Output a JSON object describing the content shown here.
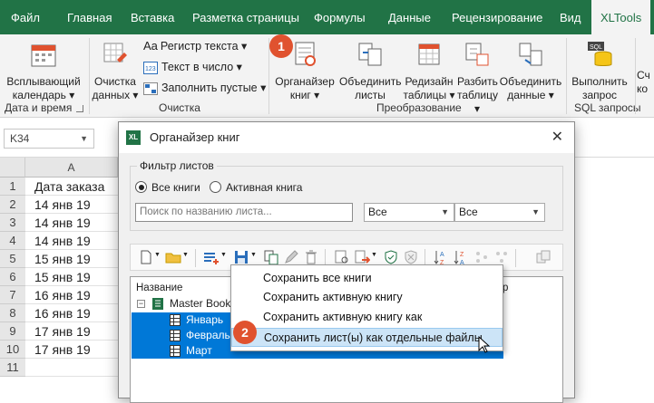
{
  "ribbon_tabs": [
    "Файл",
    "Главная",
    "Вставка",
    "Разметка страницы",
    "Формулы",
    "Данные",
    "Рецензирование",
    "Вид",
    "XLTools"
  ],
  "ribbon": {
    "calendar": {
      "line1": "Всплывающий",
      "line2": "календарь ▾"
    },
    "cleanup": {
      "line1": "Очистка",
      "line2": "данных ▾"
    },
    "small": [
      "Регистр текста ▾",
      "Текст в число ▾",
      "Заполнить пустые ▾"
    ],
    "organizer": {
      "line1": "Органайзер",
      "line2": "книг ▾"
    },
    "combine": {
      "line1": "Объединить",
      "line2": "листы"
    },
    "redesign": {
      "line1": "Редизайн",
      "line2": "таблицы ▾"
    },
    "split": {
      "line1": "Разбить",
      "line2": "таблицу ▾"
    },
    "merge": {
      "line1": "Объединить",
      "line2": "данные ▾"
    },
    "sql": {
      "line1": "Выполнить",
      "line2": "запрос"
    },
    "cut": {
      "line1": "Сч",
      "line2": "ко"
    },
    "groups": [
      "Дата и время",
      "Очистка",
      "Преобразование",
      "SQL запросы"
    ],
    "aa": "Aa"
  },
  "namebox": "K34",
  "sheet": {
    "col_a": "A",
    "rows": [
      "1",
      "2",
      "3",
      "4",
      "5",
      "6",
      "7",
      "8",
      "9",
      "10",
      "11"
    ],
    "cells": [
      "Дата заказа",
      "14 янв 19",
      "14 янв 19",
      "14 янв 19",
      "15 янв 19",
      "15 янв 19",
      "16 янв 19",
      "16 янв 19",
      "17 янв 19",
      "17 янв 19",
      ""
    ]
  },
  "dialog": {
    "badge": "XL",
    "title": "Органайзер книг",
    "close": "✕",
    "filter_legend": "Фильтр листов",
    "radio_all": "Все книги",
    "radio_active": "Активная книга",
    "search_placeholder": "Поиск по названию листа...",
    "combo1": "Все",
    "combo2": "Все",
    "tree_header": "Название",
    "tree_header_right": "р",
    "book": "Master Book",
    "sheets": [
      "Январь",
      "Февраль",
      "Март"
    ]
  },
  "menu": [
    "Сохранить все книги",
    "Сохранить активную книгу",
    "Сохранить активную книгу как",
    "Сохранить лист(ы) как отдельные файлы"
  ],
  "badges": [
    "1",
    "2"
  ],
  "colors": {
    "excel_green": "#217346",
    "selection_blue": "#0078d7",
    "badge_orange": "#e0522f",
    "menu_highlight": "#cce4f7"
  }
}
